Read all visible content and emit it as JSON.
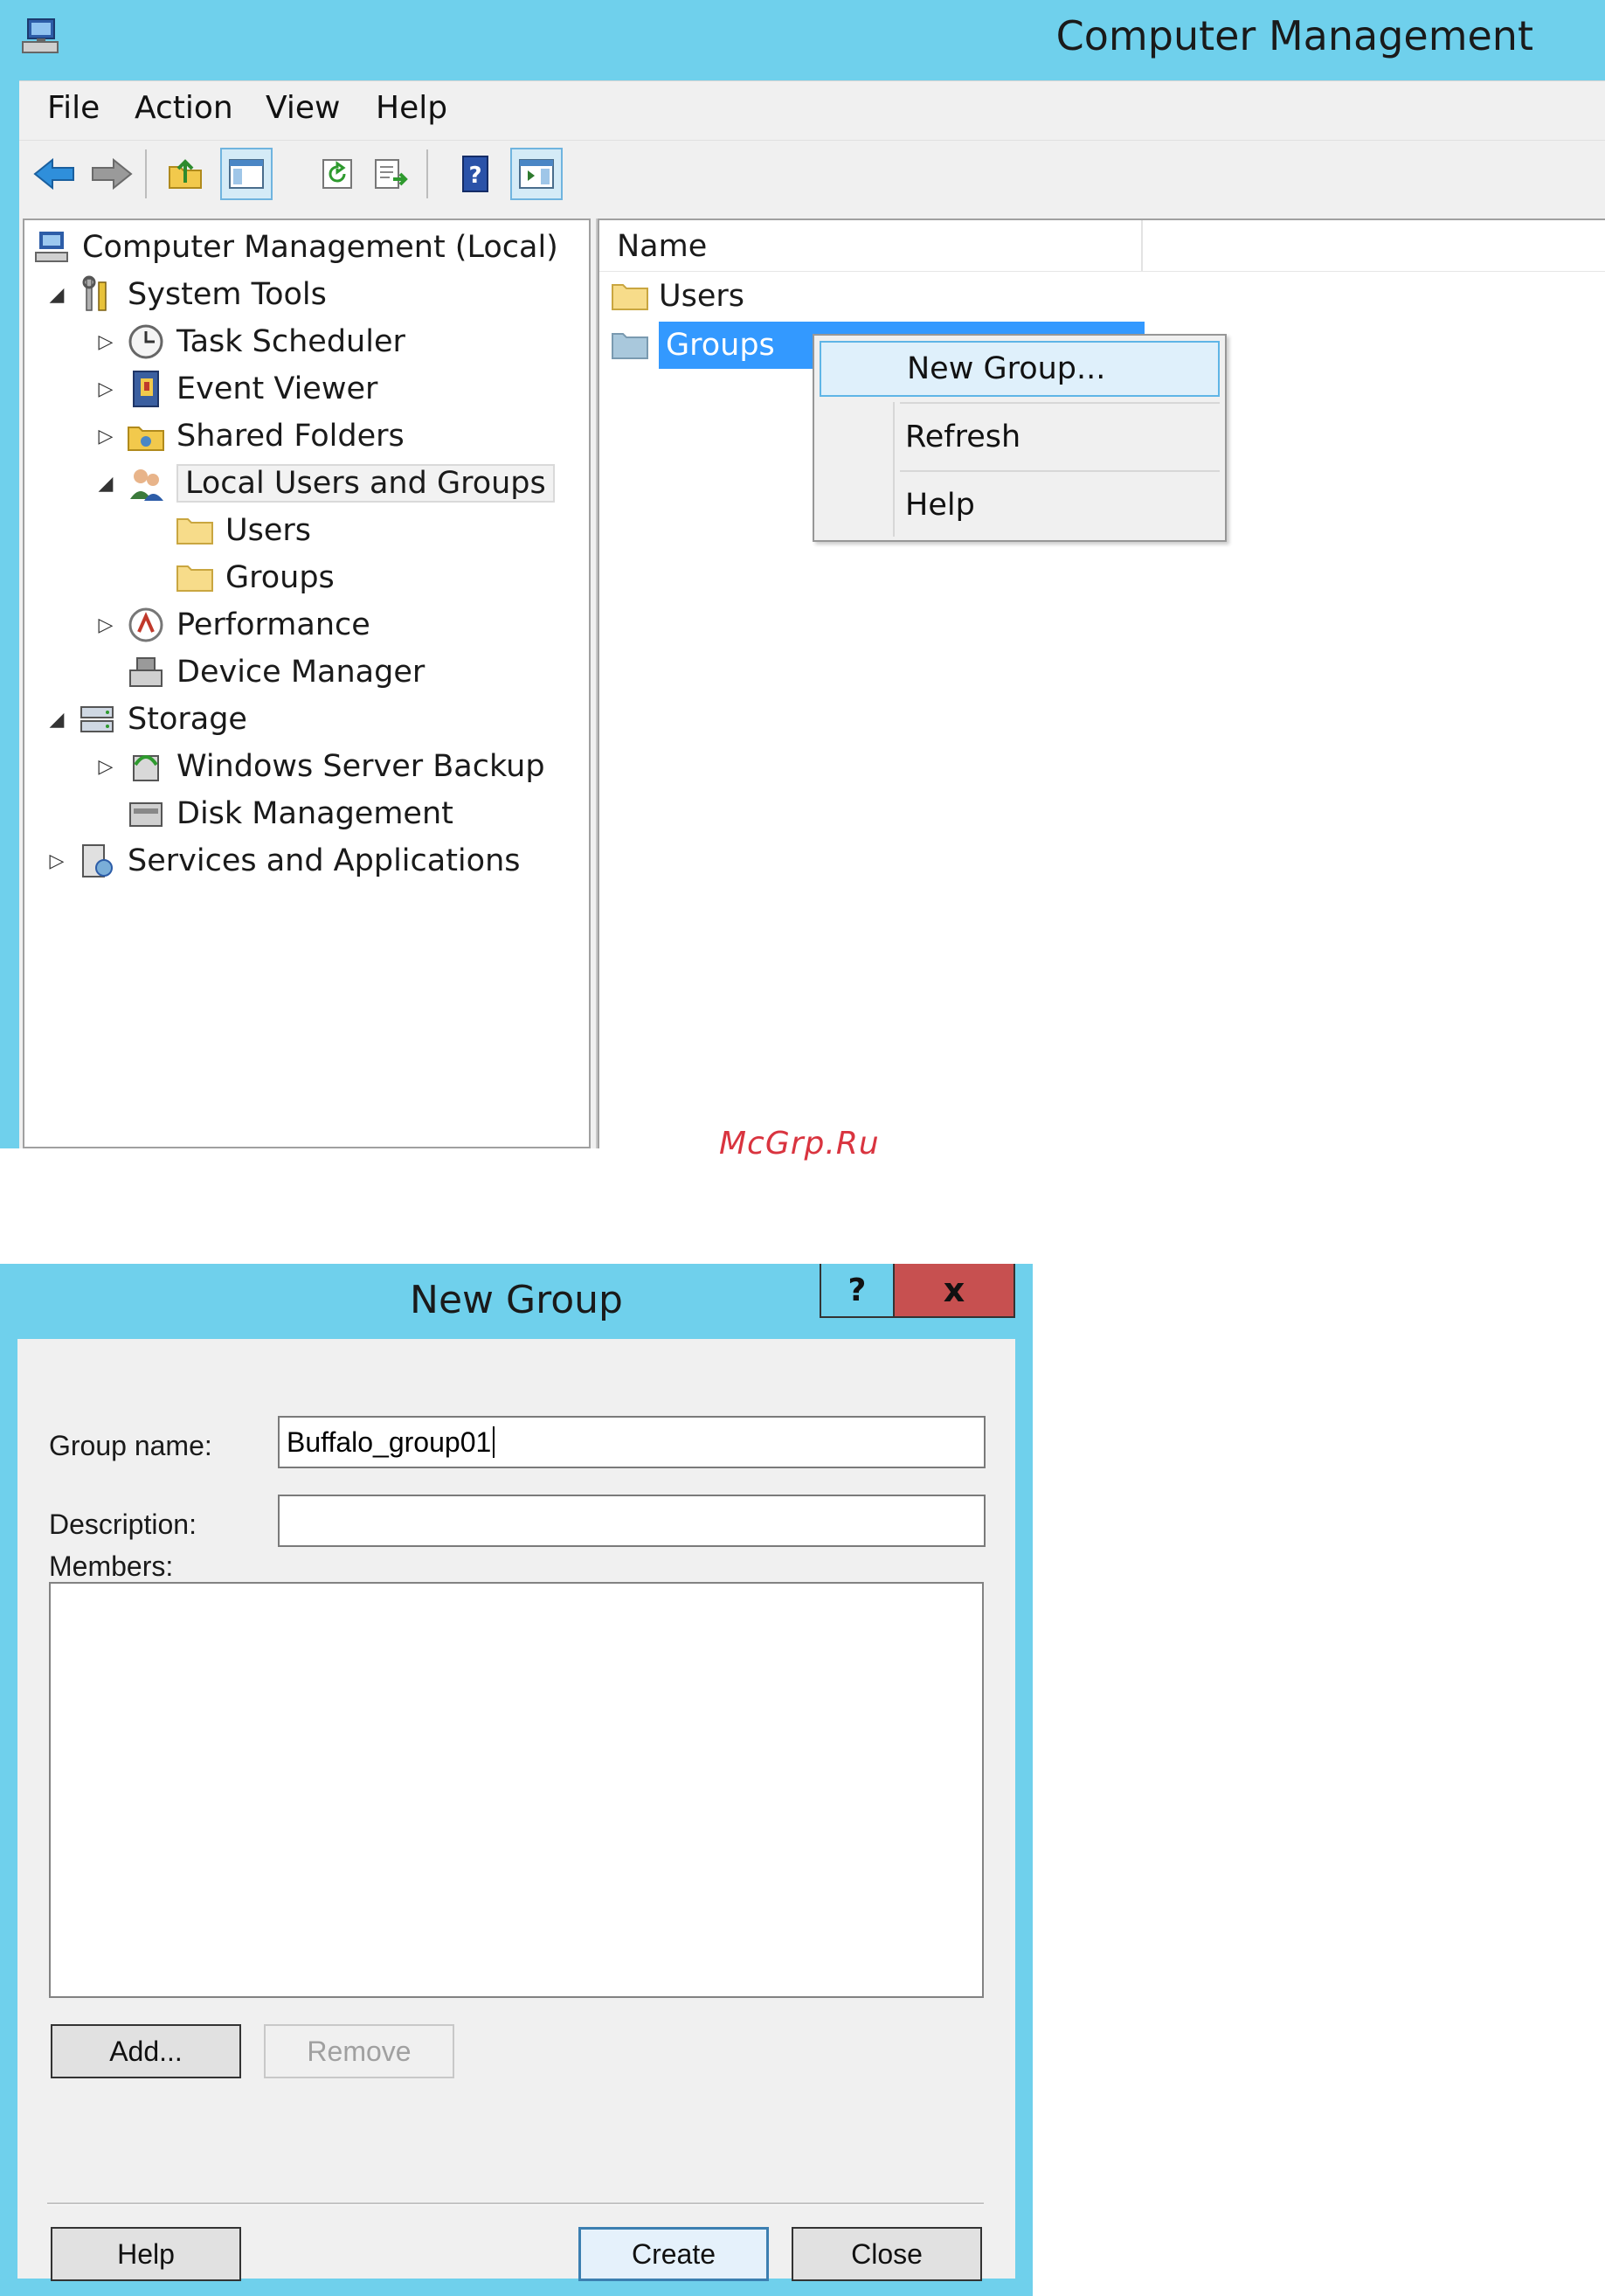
{
  "cm": {
    "title": "Computer Management",
    "menu": [
      "File",
      "Action",
      "View",
      "Help"
    ],
    "tree": [
      {
        "label": "Computer Management (Local)",
        "icon": "computer-management-icon",
        "arrow": ""
      },
      {
        "label": "System Tools",
        "icon": "tools-icon",
        "arrow": "◢"
      },
      {
        "label": "Task Scheduler",
        "icon": "clock-icon",
        "arrow": "▷"
      },
      {
        "label": "Event Viewer",
        "icon": "event-viewer-icon",
        "arrow": "▷"
      },
      {
        "label": "Shared Folders",
        "icon": "shared-folders-icon",
        "arrow": "▷"
      },
      {
        "label": "Local Users and Groups",
        "icon": "users-groups-icon",
        "arrow": "◢"
      },
      {
        "label": "Users",
        "icon": "folder-icon",
        "arrow": ""
      },
      {
        "label": "Groups",
        "icon": "folder-icon",
        "arrow": ""
      },
      {
        "label": "Performance",
        "icon": "performance-icon",
        "arrow": "▷"
      },
      {
        "label": "Device Manager",
        "icon": "device-manager-icon",
        "arrow": ""
      },
      {
        "label": "Storage",
        "icon": "storage-icon",
        "arrow": "◢"
      },
      {
        "label": "Windows Server Backup",
        "icon": "backup-icon",
        "arrow": "▷"
      },
      {
        "label": "Disk Management",
        "icon": "disk-icon",
        "arrow": ""
      },
      {
        "label": "Services and Applications",
        "icon": "services-icon",
        "arrow": "▷"
      }
    ],
    "list": {
      "column": "Name",
      "rows": [
        "Users",
        "Groups"
      ]
    },
    "context_menu": [
      "New Group...",
      "Refresh",
      "Help"
    ]
  },
  "watermark": "McGrp.Ru",
  "dialog": {
    "title": "New Group",
    "help_glyph": "?",
    "close_glyph": "x",
    "group_name_label": "Group name:",
    "group_name_value": "Buffalo_group01",
    "description_label": "Description:",
    "description_value": "",
    "members_label": "Members:",
    "add_label": "Add...",
    "remove_label": "Remove",
    "help_label": "Help",
    "create_label": "Create",
    "close_label": "Close"
  },
  "colors": {
    "title_bar": "#6fd0ec",
    "selection": "#3399ff",
    "close_button": "#c75050"
  }
}
